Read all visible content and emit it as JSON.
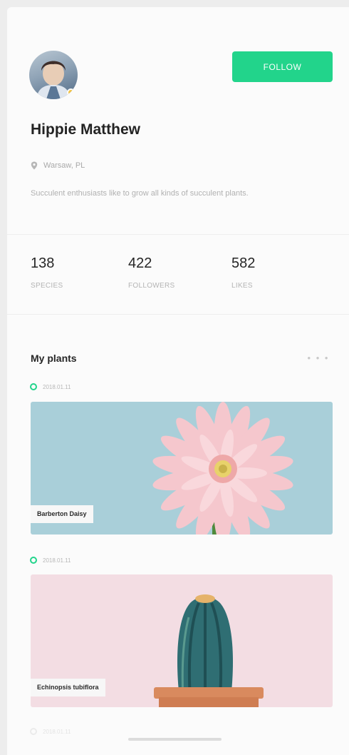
{
  "profile": {
    "name": "Hippie Matthew",
    "location": "Warsaw, PL",
    "bio": "Succulent enthusiasts like to grow all kinds of succulent plants.",
    "follow_label": "FOLLOW"
  },
  "stats": [
    {
      "value": "138",
      "label": "SPECIES"
    },
    {
      "value": "422",
      "label": "FOLLOWERS"
    },
    {
      "value": "582",
      "label": "LIKES"
    }
  ],
  "plants_section": {
    "title": "My plants",
    "more_label": "• • •",
    "entries": [
      {
        "date": "2018.01.11",
        "name": "Barberton Daisy"
      },
      {
        "date": "2018.01.11",
        "name": "Echinopsis tubiflora"
      },
      {
        "date": "2018.01.11"
      }
    ]
  },
  "colors": {
    "accent": "#22d48b",
    "daisy_background": "#a9cfd9",
    "cactus_background": "#f3dde3"
  },
  "icons": {
    "location": "location-pin-icon",
    "more": "more-dots-icon",
    "timeline": "timeline-dot-icon"
  }
}
